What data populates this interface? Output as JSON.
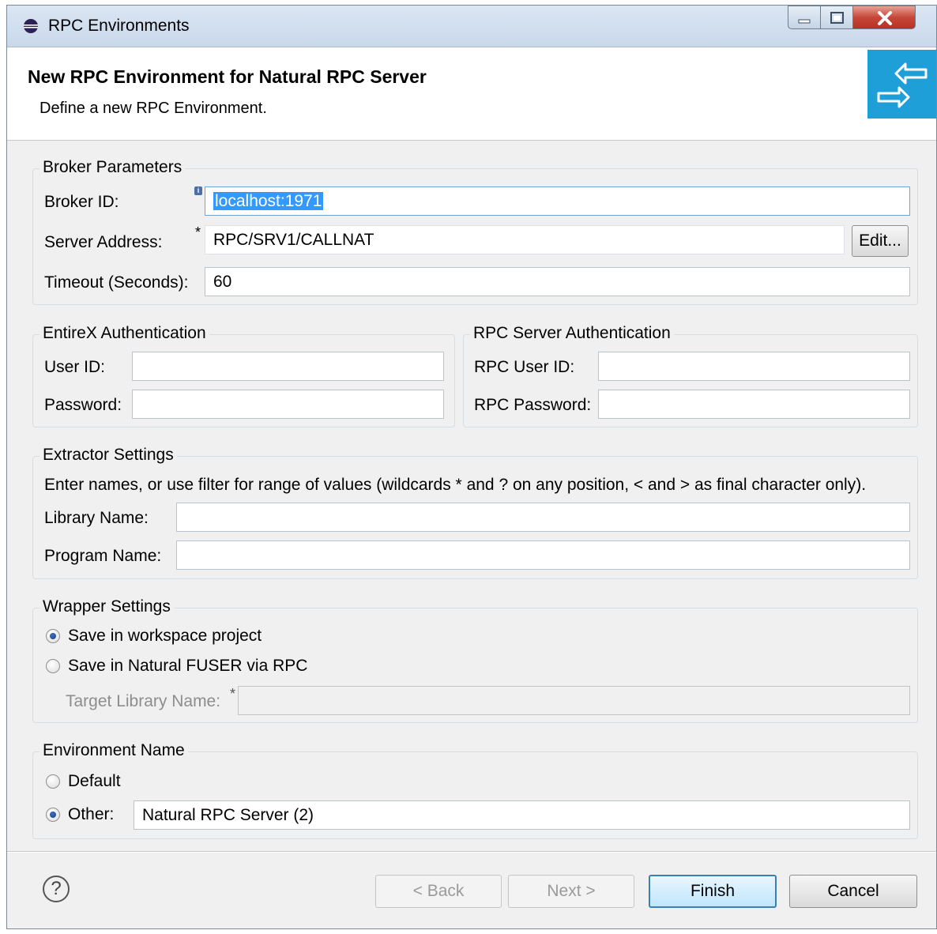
{
  "window": {
    "title": "RPC Environments",
    "controls": {
      "minimize": "minimize",
      "maximize": "maximize",
      "close": "close"
    }
  },
  "header": {
    "title": "New RPC Environment for Natural RPC Server",
    "subtitle": "Define a new RPC Environment.",
    "banner_icon": "arrows-exchange-icon",
    "banner_color": "#1e9fd8"
  },
  "broker": {
    "legend": "Broker Parameters",
    "broker_id_label": "Broker ID:",
    "broker_id_value": "localhost:1971",
    "server_address_label": "Server Address:",
    "server_address_value": "RPC/SRV1/CALLNAT",
    "required_marker": "*",
    "edit_button": "Edit...",
    "timeout_label": "Timeout (Seconds):",
    "timeout_value": "60"
  },
  "entirex": {
    "legend": "EntireX Authentication",
    "user_label": "User ID:",
    "user_value": "",
    "password_label": "Password:",
    "password_value": ""
  },
  "rpc_auth": {
    "legend": "RPC Server Authentication",
    "user_label": "RPC User ID:",
    "user_value": "",
    "password_label": "RPC Password:",
    "password_value": ""
  },
  "extractor": {
    "legend": "Extractor Settings",
    "hint": "Enter names, or use filter for range of values (wildcards * and ? on any position, < and > as final character only).",
    "library_label": "Library Name:",
    "library_value": "",
    "program_label": "Program Name:",
    "program_value": ""
  },
  "wrapper": {
    "legend": "Wrapper Settings",
    "option_workspace": "Save in workspace project",
    "option_fuser": "Save in Natural FUSER via RPC",
    "selected": "workspace",
    "target_library_label": "Target Library Name:",
    "required_marker": "*",
    "target_library_value": ""
  },
  "environment": {
    "legend": "Environment Name",
    "option_default": "Default",
    "option_other": "Other:",
    "selected": "other",
    "other_value": "Natural RPC Server (2)"
  },
  "footer": {
    "help_icon": "?",
    "back_button": "< Back",
    "next_button": "Next >",
    "finish_button": "Finish",
    "cancel_button": "Cancel"
  }
}
